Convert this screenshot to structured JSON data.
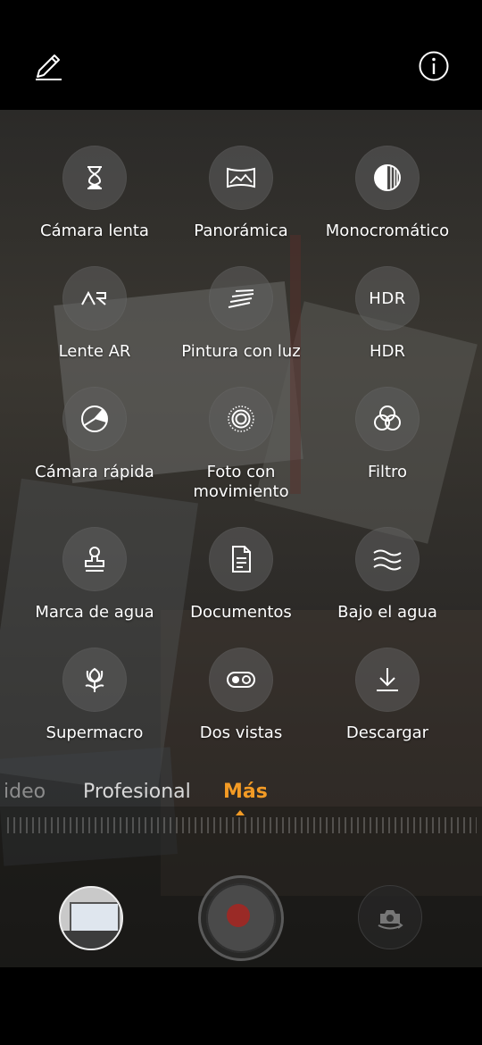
{
  "topbar": {
    "edit_icon": "pencil-icon",
    "info_icon": "info-icon"
  },
  "modes_grid": [
    {
      "label": "Cámara lenta",
      "icon": "hourglass-icon"
    },
    {
      "label": "Panorámica",
      "icon": "panorama-icon"
    },
    {
      "label": "Monocromático",
      "icon": "monochrome-icon"
    },
    {
      "label": "Lente AR",
      "icon": "ar-lens-icon"
    },
    {
      "label": "Pintura con luz",
      "icon": "light-painting-icon"
    },
    {
      "label": "HDR",
      "icon": "hdr-icon"
    },
    {
      "label": "Cámara rápida",
      "icon": "time-lapse-icon"
    },
    {
      "label": "Foto con movimiento",
      "icon": "moving-picture-icon"
    },
    {
      "label": "Filtro",
      "icon": "filter-icon"
    },
    {
      "label": "Marca de agua",
      "icon": "watermark-stamp-icon"
    },
    {
      "label": "Documentos",
      "icon": "document-icon"
    },
    {
      "label": "Bajo el agua",
      "icon": "waves-icon"
    },
    {
      "label": "Supermacro",
      "icon": "flower-macro-icon"
    },
    {
      "label": "Dos vistas",
      "icon": "dual-view-icon"
    },
    {
      "label": "Descargar",
      "icon": "download-icon"
    }
  ],
  "mode_bar": {
    "items": [
      "Video",
      "Profesional",
      "Más"
    ],
    "visible_video": "ideo",
    "selected": "Más",
    "accent": "#f39b25"
  },
  "hdr_text": "HDR",
  "ar_text": "AR",
  "controls": {
    "gallery": "gallery-thumbnail",
    "shutter": "record-button",
    "switch": "switch-camera-icon"
  }
}
